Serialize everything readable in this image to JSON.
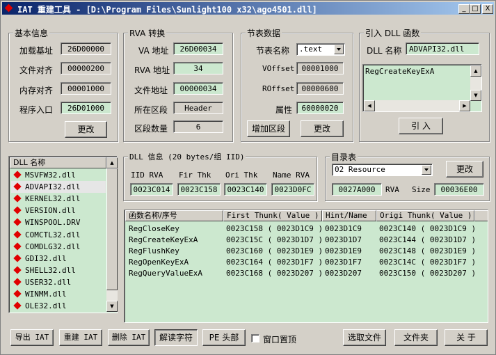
{
  "window": {
    "title": "IAT 重建工具 - [D:\\Program Files\\Sunlight100 x32\\ago4501.dll]",
    "minimize": "_",
    "maximize": "□",
    "close": "X"
  },
  "basic_info": {
    "title": "基本信息",
    "load_base_label": "加载基址",
    "load_base": "26D00000",
    "file_align_label": "文件对齐",
    "file_align": "00000200",
    "mem_align_label": "内存对齐",
    "mem_align": "00001000",
    "entry_label": "程序入口",
    "entry": "26D01000",
    "change_button": "更改"
  },
  "rva_convert": {
    "title": "RVA 转换",
    "va_label": "VA 地址",
    "va": "26D00034",
    "rva_label": "RVA 地址",
    "rva": "34",
    "file_addr_label": "文件地址",
    "file_addr": "00000034",
    "section_label": "所在区段",
    "section": "Header",
    "count_label": "区段数量",
    "count": "6"
  },
  "section_data": {
    "title": "节表数据",
    "name_label": "节表名称",
    "name": ".text",
    "voffset_label": "VOffset",
    "voffset": "00001000",
    "roffset_label": "ROffset",
    "roffset": "00000600",
    "attr_label": "属性",
    "attr": "60000020",
    "add_button": "增加区段",
    "change_button": "更改"
  },
  "import_func": {
    "title": "引入 DLL 函数",
    "dll_label": "DLL 名称",
    "dll_name": "ADVAPI32.dll",
    "func": "RegCreateKeyExA",
    "import_button": "引 入"
  },
  "dll_list": {
    "header": "DLL 名称",
    "items": [
      "MSVFW32.dll",
      "ADVAPI32.dll",
      "KERNEL32.dll",
      "VERSION.dll",
      "WINSPOOL.DRV",
      "COMCTL32.dll",
      "COMDLG32.dll",
      "GDI32.dll",
      "SHELL32.dll",
      "USER32.dll",
      "WINMM.dll",
      "OLE32.dll"
    ],
    "selected_index": 1
  },
  "dll_info": {
    "title": "DLL 信息 (20 bytes/组 IID)",
    "iid_rva_label": "IID RVA",
    "iid_rva": "0023C014",
    "fir_thk_label": "Fir Thk",
    "fir_thk": "0023C158",
    "ori_thk_label": "Ori Thk",
    "ori_thk": "0023C140",
    "name_rva_label": "Name RVA",
    "name_rva": "0023D0FC"
  },
  "directory": {
    "title": "目录表",
    "selected": "02 Resource",
    "change_button": "更改",
    "rva_value": "0027A000",
    "rva_label": "RVA",
    "size_label": "Size",
    "size_value": "00036E00"
  },
  "func_table": {
    "columns": [
      "函数名称/序号",
      "First Thunk( Value )",
      "Hint/Name",
      "Origi Thunk( Value )"
    ],
    "rows": [
      [
        "RegCloseKey",
        "0023C158 ( 0023D1C9 )",
        "0023D1C9",
        "0023C140 ( 0023D1C9 )"
      ],
      [
        "RegCreateKeyExA",
        "0023C15C ( 0023D1D7 )",
        "0023D1D7",
        "0023C144 ( 0023D1D7 )"
      ],
      [
        "RegFlushKey",
        "0023C160 ( 0023D1E9 )",
        "0023D1E9",
        "0023C148 ( 0023D1E9 )"
      ],
      [
        "RegOpenKeyExA",
        "0023C164 ( 0023D1F7 )",
        "0023D1F7",
        "0023C14C ( 0023D1F7 )"
      ],
      [
        "RegQueryValueExA",
        "0023C168 ( 0023D207 )",
        "0023D207",
        "0023C150 ( 0023D207 )"
      ]
    ]
  },
  "bottom": {
    "export_iat": "导出 IAT",
    "rebuild_iat": "重建 IAT",
    "delete_iat": "删除 IAT",
    "decode_str": "解读字符",
    "pe_header": "PE 头部",
    "window_top": "窗口置顶",
    "select_file": "选取文件",
    "folder": "文件夹",
    "about": "关 于"
  },
  "colors": {
    "field_green": "#cce8cf",
    "title_blue": "#0a246a",
    "marker_red": "#e00000"
  }
}
